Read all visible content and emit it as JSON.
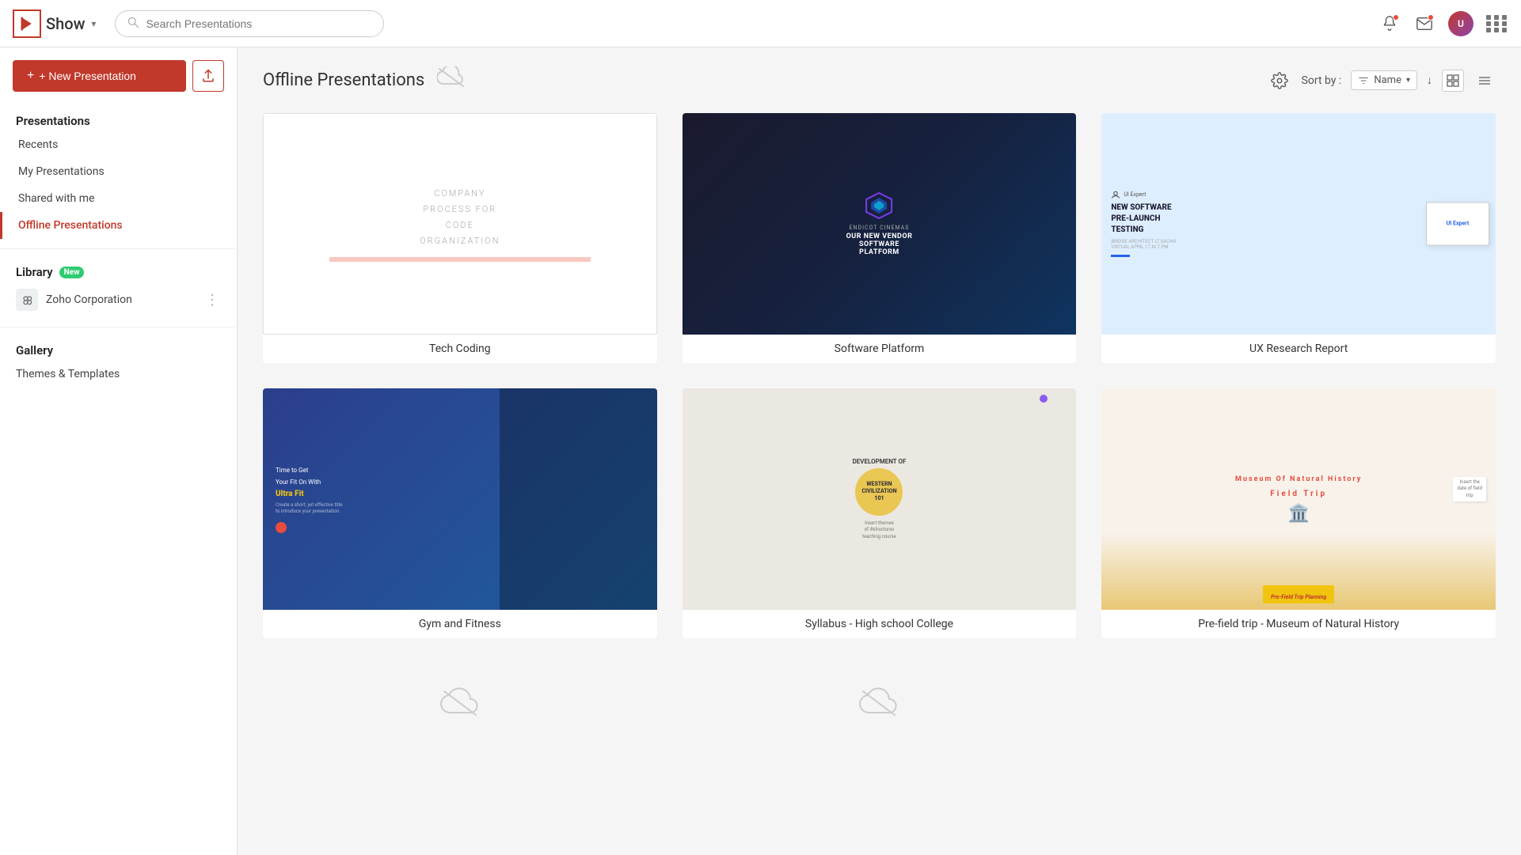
{
  "app": {
    "logo_text": "Show",
    "logo_chevron": "▾"
  },
  "topnav": {
    "search_placeholder": "Search Presentations"
  },
  "sidebar": {
    "new_button": "+ New Presentation",
    "section_presentations": "Presentations",
    "nav_recents": "Recents",
    "nav_my_presentations": "My Presentations",
    "nav_shared": "Shared with me",
    "nav_offline": "Offline Presentations",
    "section_library": "Library",
    "badge_new": "New",
    "library_item": "Zoho Corporation",
    "section_gallery": "Gallery",
    "nav_themes": "Themes & Templates"
  },
  "main": {
    "offline_title": "Offline Presentations",
    "sort_label": "Sort by :",
    "sort_option": "Name",
    "cards": [
      {
        "id": "tech-coding",
        "name": "Tech Coding",
        "thumb_type": "tech"
      },
      {
        "id": "software-platform",
        "name": "Software Platform",
        "thumb_type": "software"
      },
      {
        "id": "ux-research",
        "name": "UX Research Report",
        "thumb_type": "ux"
      },
      {
        "id": "gym-fitness",
        "name": "Gym and Fitness",
        "thumb_type": "gym"
      },
      {
        "id": "syllabus",
        "name": "Syllabus - High school College",
        "thumb_type": "syllabus"
      },
      {
        "id": "museum",
        "name": "Pre-field trip - Museum of Natural History",
        "thumb_type": "museum"
      }
    ]
  }
}
